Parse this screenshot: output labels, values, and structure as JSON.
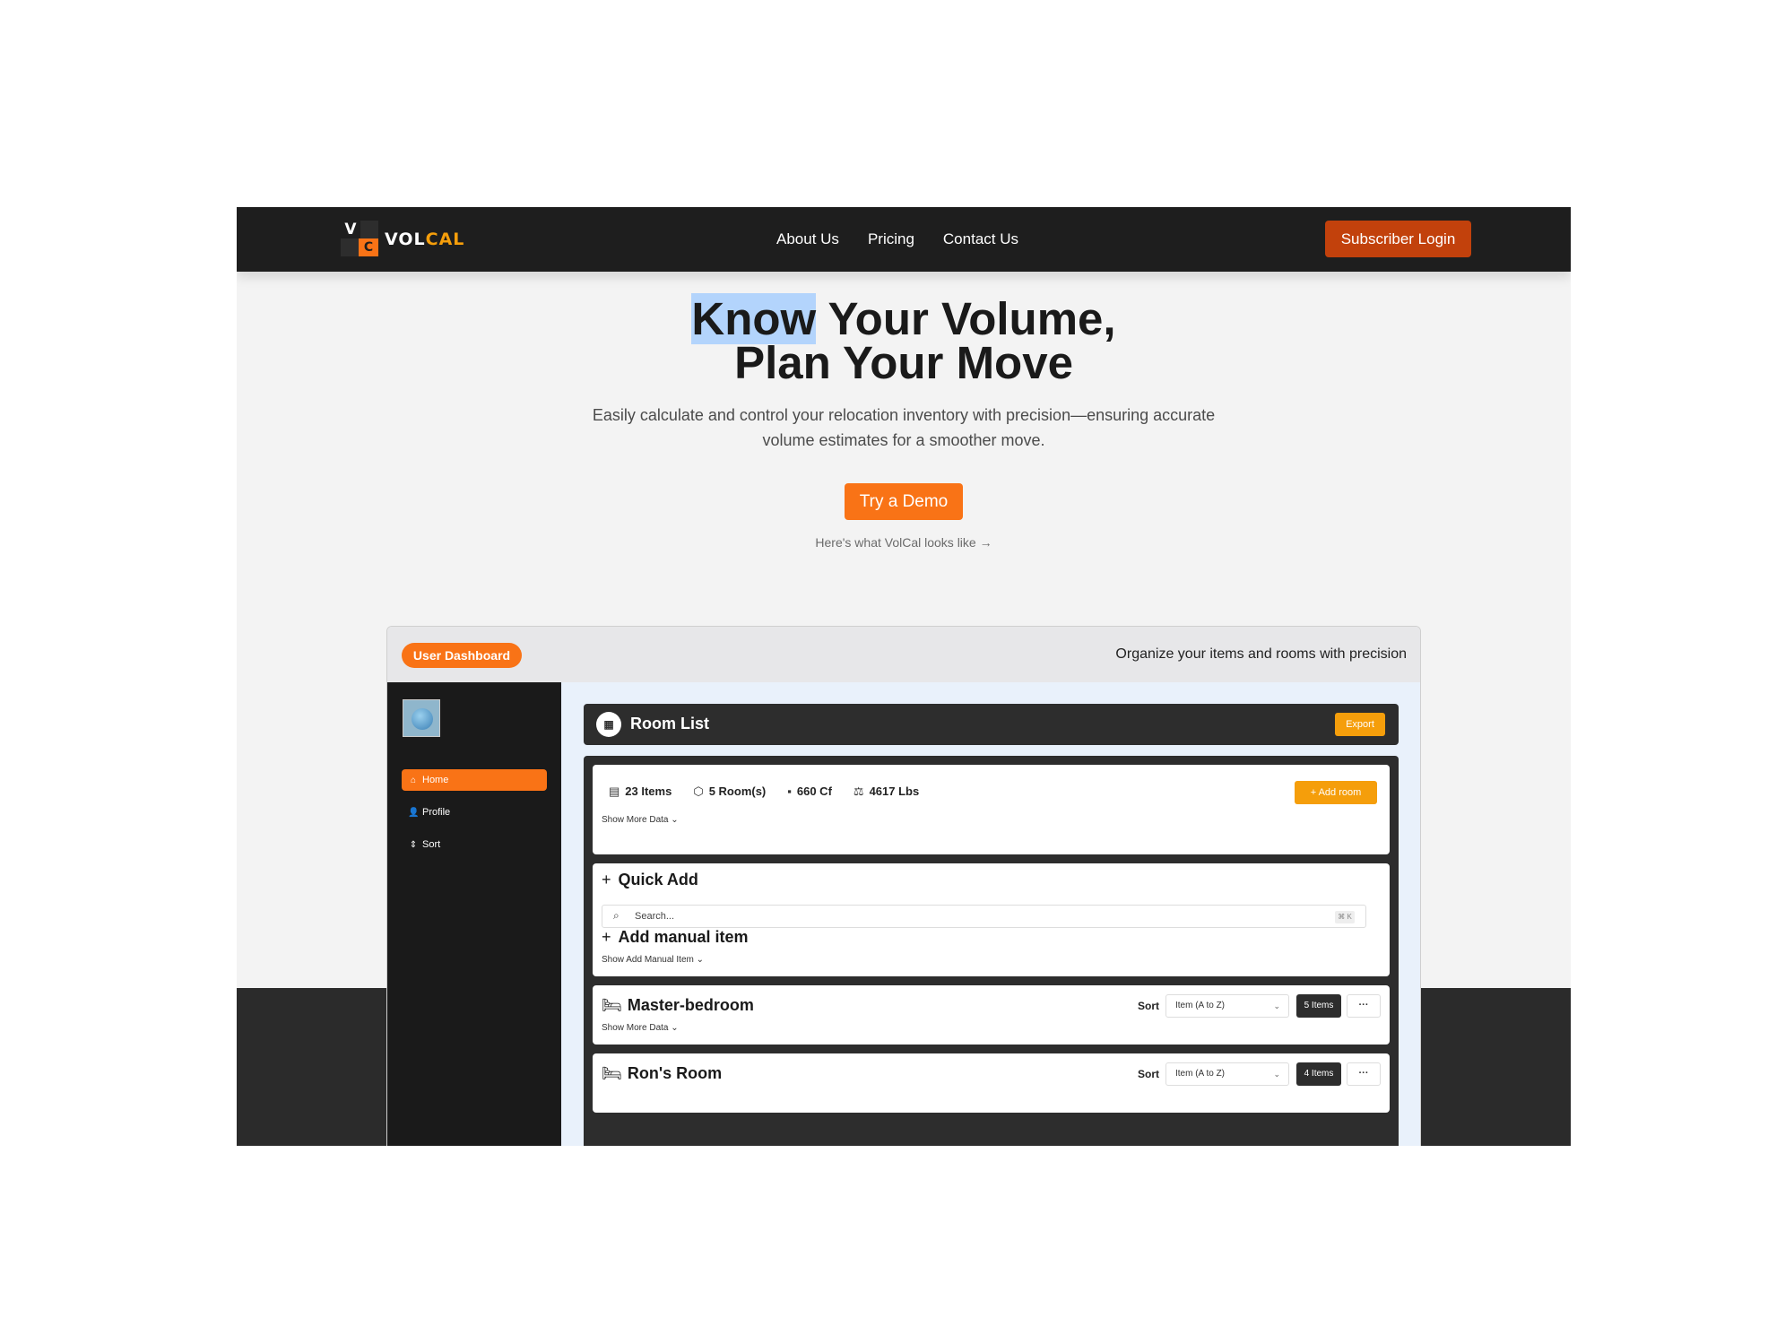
{
  "nav": {
    "logo": {
      "letter_v": "V",
      "letter_c": "C",
      "word_a": "VOL",
      "word_b": "CAL"
    },
    "links": [
      "About Us",
      "Pricing",
      "Contact Us"
    ],
    "login_label": "Subscriber Login"
  },
  "hero": {
    "title_word_highlighted": "Know",
    "title_rest_line1": " Your Volume,",
    "title_line2": "Plan Your Move",
    "subtitle": "Easily calculate and control your relocation inventory with precision—ensuring accurate volume estimates for a smoother move.",
    "cta_label": "Try a Demo",
    "hint": "Here's what VolCal looks like →"
  },
  "dashboard": {
    "pill_label": "User Dashboard",
    "tagline": "Organize your items and rooms with precision",
    "sidebar": {
      "items": [
        {
          "label": "Home",
          "icon": "home-icon",
          "glyph": "⌂"
        },
        {
          "label": "Profile",
          "icon": "user-icon",
          "glyph": "👤"
        },
        {
          "label": "Sort",
          "icon": "sort-icon",
          "glyph": "⇕"
        }
      ]
    },
    "room_list": {
      "title": "Room List",
      "icon_glyph": "▦",
      "export_label": "Export",
      "stats": {
        "items": "23 Items",
        "rooms": "5 Room(s)",
        "cf": "660 Cf",
        "lbs": "4617 Lbs"
      },
      "stat_glyphs": {
        "items": "▤",
        "rooms": "⬡",
        "cf": "▪",
        "lbs": "⚖"
      },
      "add_room_label": "+ Add room",
      "show_more": "Show More Data ⌄"
    },
    "quick_add": {
      "title": "Quick Add",
      "search_placeholder": "Search...",
      "shortcut": "⌘ K",
      "manual_title": "Add manual item",
      "manual_toggle": "Show Add Manual Item ⌄"
    },
    "rooms": [
      {
        "name": "Master-bedroom",
        "sort_label": "Sort",
        "sort_value": "Item (A to Z)",
        "count": "5 Items",
        "more": "···",
        "show_more": "Show More Data ⌄"
      },
      {
        "name": "Ron's Room",
        "sort_label": "Sort",
        "sort_value": "Item (A to Z)",
        "count": "4 Items",
        "more": "···"
      }
    ]
  },
  "colors": {
    "accent": "#f97316",
    "login": "#c2410c",
    "dark": "#1e1e1e"
  }
}
